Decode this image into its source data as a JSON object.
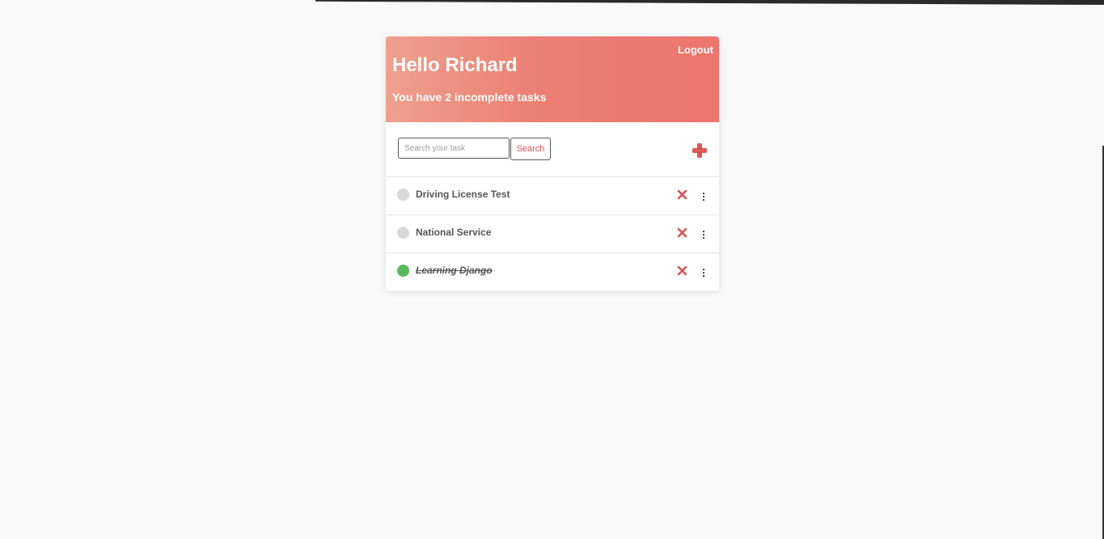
{
  "header": {
    "logout_label": "Logout",
    "greeting": "Hello Richard",
    "subtitle": "You have 2 incomplete tasks",
    "gradient_start": "#eea08e",
    "gradient_end": "#ec756e"
  },
  "toolbar": {
    "search_placeholder": "Search your task",
    "search_value": "",
    "search_button_label": "Search",
    "add_icon": "plus-icon"
  },
  "tasks": [
    {
      "title": "Driving License Test",
      "completed": false
    },
    {
      "title": "National Service",
      "completed": false
    },
    {
      "title": "Learning Django",
      "completed": true
    }
  ],
  "colors": {
    "accent": "#d9534f",
    "complete": "#5cb85c",
    "incomplete": "#d8d8d8"
  }
}
